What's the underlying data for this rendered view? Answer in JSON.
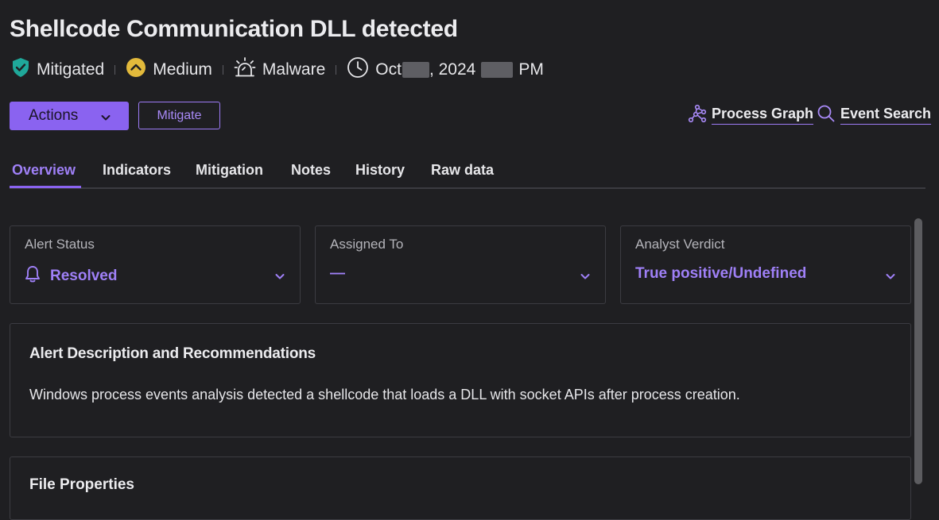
{
  "alert": {
    "title": "Shellcode Communication DLL detected",
    "status": "Mitigated",
    "severity": "Medium",
    "category": "Malware",
    "date_prefix": "Oct",
    "date_year": ", 2024",
    "time_suffix": "PM"
  },
  "toolbar": {
    "actions_label": "Actions",
    "mitigate_label": "Mitigate",
    "process_graph_label": "Process Graph",
    "event_search_label": "Event Search"
  },
  "tabs": [
    {
      "label": "Overview",
      "active": true
    },
    {
      "label": "Indicators"
    },
    {
      "label": "Mitigation"
    },
    {
      "label": "Notes"
    },
    {
      "label": "History"
    },
    {
      "label": "Raw data"
    }
  ],
  "fields": {
    "alert_status": {
      "label": "Alert Status",
      "value": "Resolved"
    },
    "assigned_to": {
      "label": "Assigned To",
      "value": "—"
    },
    "analyst_verdict": {
      "label": "Analyst Verdict",
      "value": "True positive/Undefined"
    }
  },
  "description": {
    "title": "Alert Description and Recommendations",
    "text": "Windows process events analysis detected a shellcode that loads a DLL with socket APIs after process creation."
  },
  "next_section": {
    "title": "File Properties"
  },
  "icons": {
    "shield": "shield-check-icon",
    "severity": "severity-medium-icon",
    "malware": "siren-icon",
    "time": "clock-icon",
    "bell": "bell-icon"
  },
  "colors": {
    "accent": "#8a63f0",
    "accent_text": "#9f80f7",
    "mitigated": "#1fa89a",
    "medium": "#e2b93b",
    "background": "#1f1f22"
  }
}
